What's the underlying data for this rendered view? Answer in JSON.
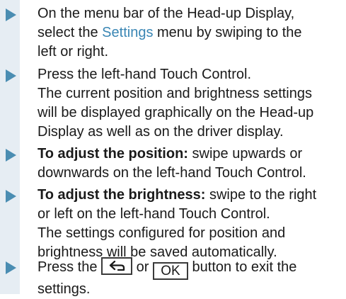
{
  "steps": [
    {
      "parts": [
        "On the menu bar of the Head-up Display,",
        "select the ",
        "Settings",
        " menu by swiping to the",
        "left or right."
      ]
    },
    {
      "lines": [
        "Press the left-hand Touch Control.",
        "The current position and brightness settings",
        "will be displayed graphically on the Head-up",
        "Display as well as on the driver display."
      ]
    },
    {
      "bold": "To adjust the position:",
      "rest": " swipe upwards or",
      "line2": "downwards on the left-hand Touch Control."
    },
    {
      "bold": "To adjust the brightness:",
      "rest": " swipe to the right",
      "lines": [
        "or left on the left-hand Touch Control.",
        "The settings configured for position and",
        "brightness will be saved automatically."
      ]
    },
    {
      "pre": "Press the ",
      "back_key_icon": "back-arrow-icon",
      "mid": " or ",
      "ok_key": "OK",
      "post": " button to exit the",
      "line2": "settings."
    }
  ],
  "colors": {
    "accent": "#3a86b4",
    "marker": "#4a8db2",
    "stripe": "#e6edf3"
  }
}
